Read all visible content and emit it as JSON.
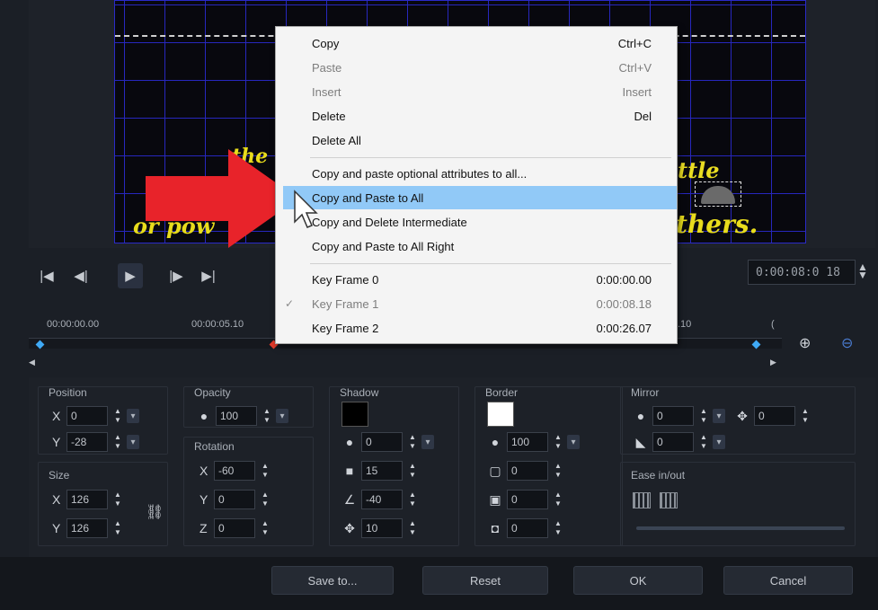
{
  "video": {
    "caption_line1_left": "the",
    "caption_line1_right": "ttle",
    "caption_line2_left": "or pow",
    "caption_line2_right": "thers."
  },
  "transport": {
    "timecode": "0:00:08:0 18"
  },
  "timeline": {
    "labels": [
      "00:00:00.00",
      "00:00:05.10",
      ".10",
      "("
    ]
  },
  "position": {
    "title": "Position",
    "x": "0",
    "y": "-28"
  },
  "size": {
    "title": "Size",
    "x": "126",
    "y": "126"
  },
  "opacity": {
    "title": "Opacity",
    "value": "100"
  },
  "rotation": {
    "title": "Rotation",
    "x": "-60",
    "y": "0",
    "z": "0"
  },
  "shadow": {
    "title": "Shadow",
    "opacity": "0",
    "blur": "15",
    "angle": "-40",
    "distance": "10",
    "color": "#000000"
  },
  "border": {
    "title": "Border",
    "opacity": "100",
    "width": "0",
    "blur": "0",
    "corner": "0",
    "color": "#ffffff"
  },
  "mirror": {
    "title": "Mirror",
    "top": "0",
    "bottom": "0",
    "offset": "0"
  },
  "ease": {
    "title": "Ease in/out"
  },
  "footer": {
    "save": "Save to...",
    "reset": "Reset",
    "ok": "OK",
    "cancel": "Cancel"
  },
  "menu": {
    "items": [
      {
        "label": "Copy",
        "shortcut": "Ctrl+C"
      },
      {
        "label": "Paste",
        "shortcut": "Ctrl+V"
      },
      {
        "label": "Insert",
        "shortcut": "Insert"
      },
      {
        "label": "Delete",
        "shortcut": "Del"
      },
      {
        "label": "Delete All",
        "shortcut": ""
      },
      {
        "label": "Copy and paste optional attributes to all...",
        "shortcut": ""
      },
      {
        "label": "Copy and Paste to All",
        "shortcut": ""
      },
      {
        "label": "Copy and Delete Intermediate",
        "shortcut": ""
      },
      {
        "label": "Copy and Paste to All Right",
        "shortcut": ""
      },
      {
        "label": "Key  Frame  0",
        "shortcut": "0:00:00.00"
      },
      {
        "label": "Key  Frame  1",
        "shortcut": "0:00:08.18"
      },
      {
        "label": "Key  Frame  2",
        "shortcut": "0:00:26.07"
      }
    ]
  },
  "colors": {
    "accent": "#91c9f7",
    "keyframe": "#3fa9f5",
    "marker": "#e03a2a",
    "arrow": "#e8232a"
  }
}
